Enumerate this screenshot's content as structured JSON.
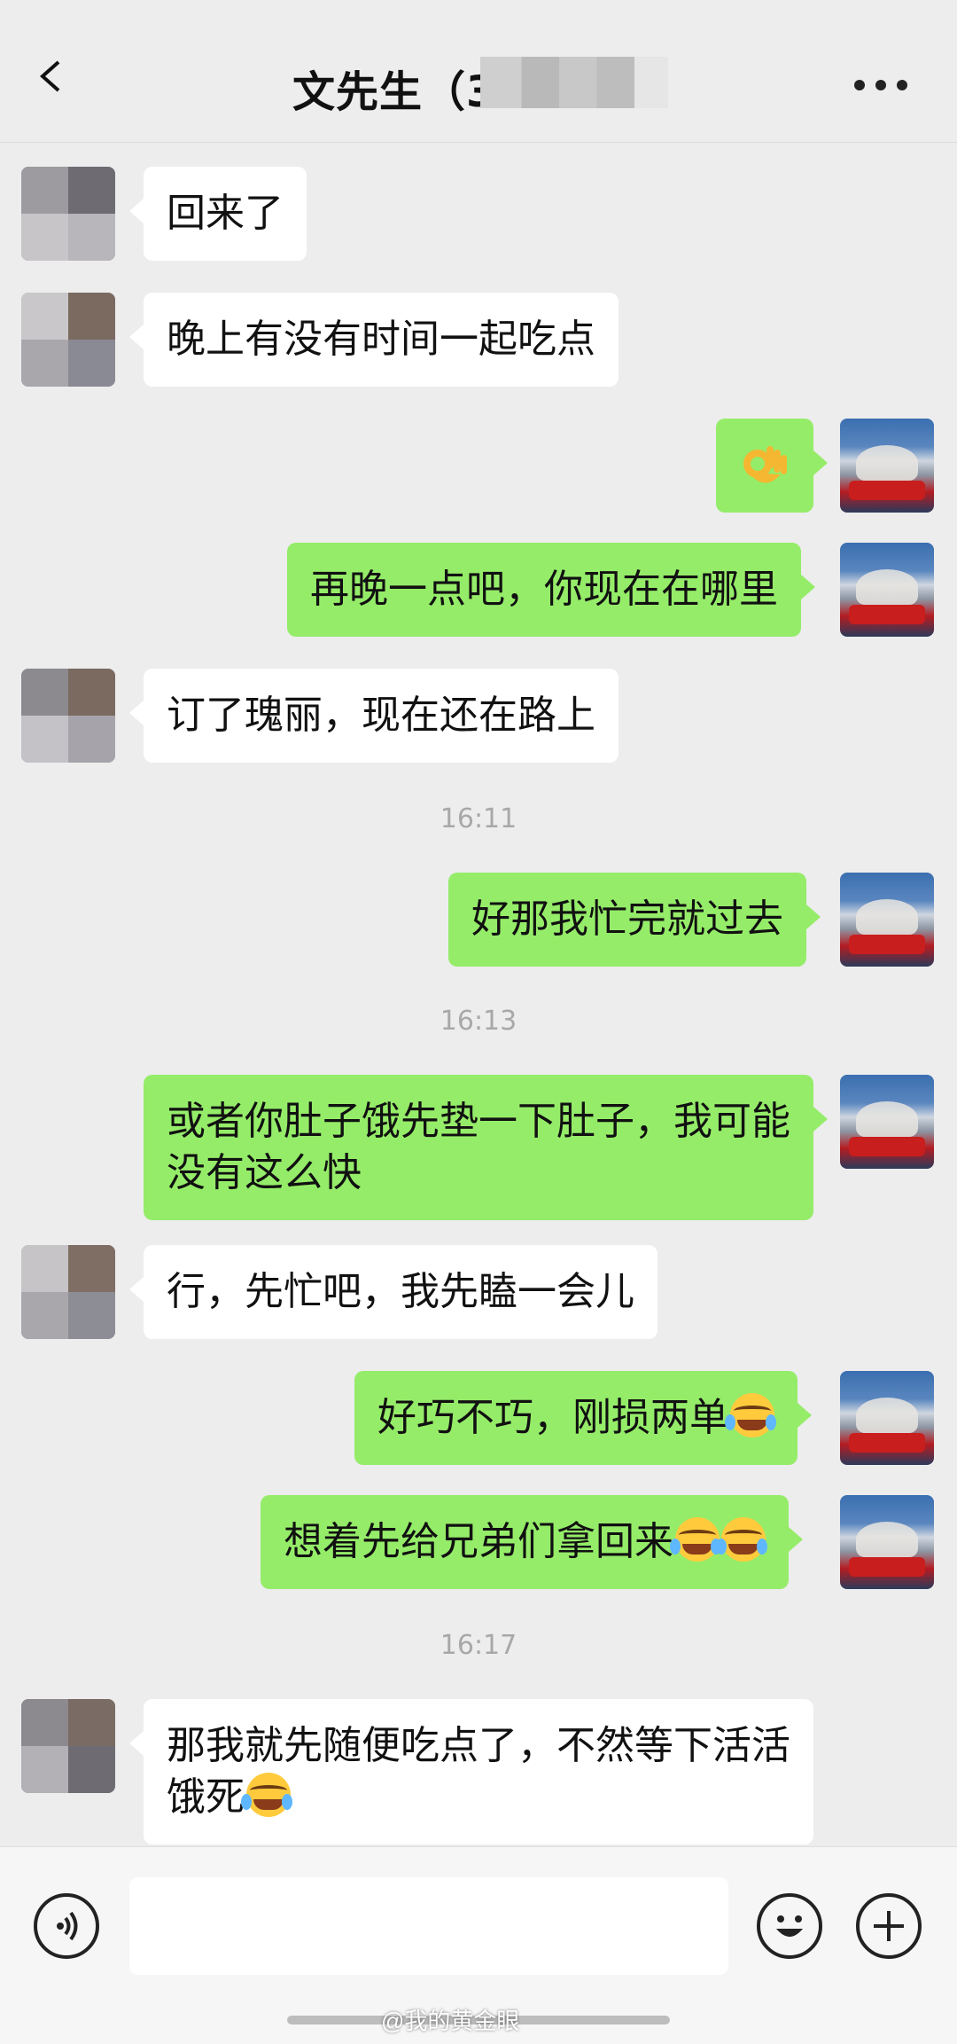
{
  "header": {
    "title": "文先生（3",
    "back_icon": "chevron-left-icon",
    "more_icon": "more-horizontal-icon"
  },
  "messages": [
    {
      "side": "in",
      "text": "回来了"
    },
    {
      "side": "in",
      "text": "晚上有没有时间一起吃点"
    },
    {
      "side": "out",
      "text": "",
      "emoji": "ok-hand-emoji"
    },
    {
      "side": "out",
      "text": "再晚一点吧，你现在在哪里"
    },
    {
      "side": "in",
      "text": "订了瑰丽，现在还在路上"
    },
    {
      "time": "16:11"
    },
    {
      "side": "out",
      "text": "好那我忙完就过去"
    },
    {
      "time": "16:13"
    },
    {
      "side": "out",
      "text": "或者你肚子饿先垫一下肚子，我可能没有这么快"
    },
    {
      "side": "in",
      "text": "行，先忙吧，我先瞌一会儿"
    },
    {
      "side": "out",
      "text": "好巧不巧，刚损两单",
      "emoji": "laughing-crying-emoji"
    },
    {
      "side": "out",
      "text": "想着先给兄弟们拿回来",
      "emoji": "laughing-crying-emoji x2"
    },
    {
      "time": "16:17"
    },
    {
      "side": "in",
      "text": "那我就先随便吃点了，不然等下活活饿死",
      "emoji": "laughing-crying-emoji"
    }
  ],
  "footer": {
    "voice_icon": "voice-icon",
    "emoji_icon": "smiley-icon",
    "plus_icon": "plus-icon",
    "watermark": "@我的黄金眼"
  },
  "colors": {
    "background": "#ededed",
    "self_bubble": "#95ec69",
    "other_bubble": "#ffffff",
    "timestamp": "#a8a8a8"
  }
}
